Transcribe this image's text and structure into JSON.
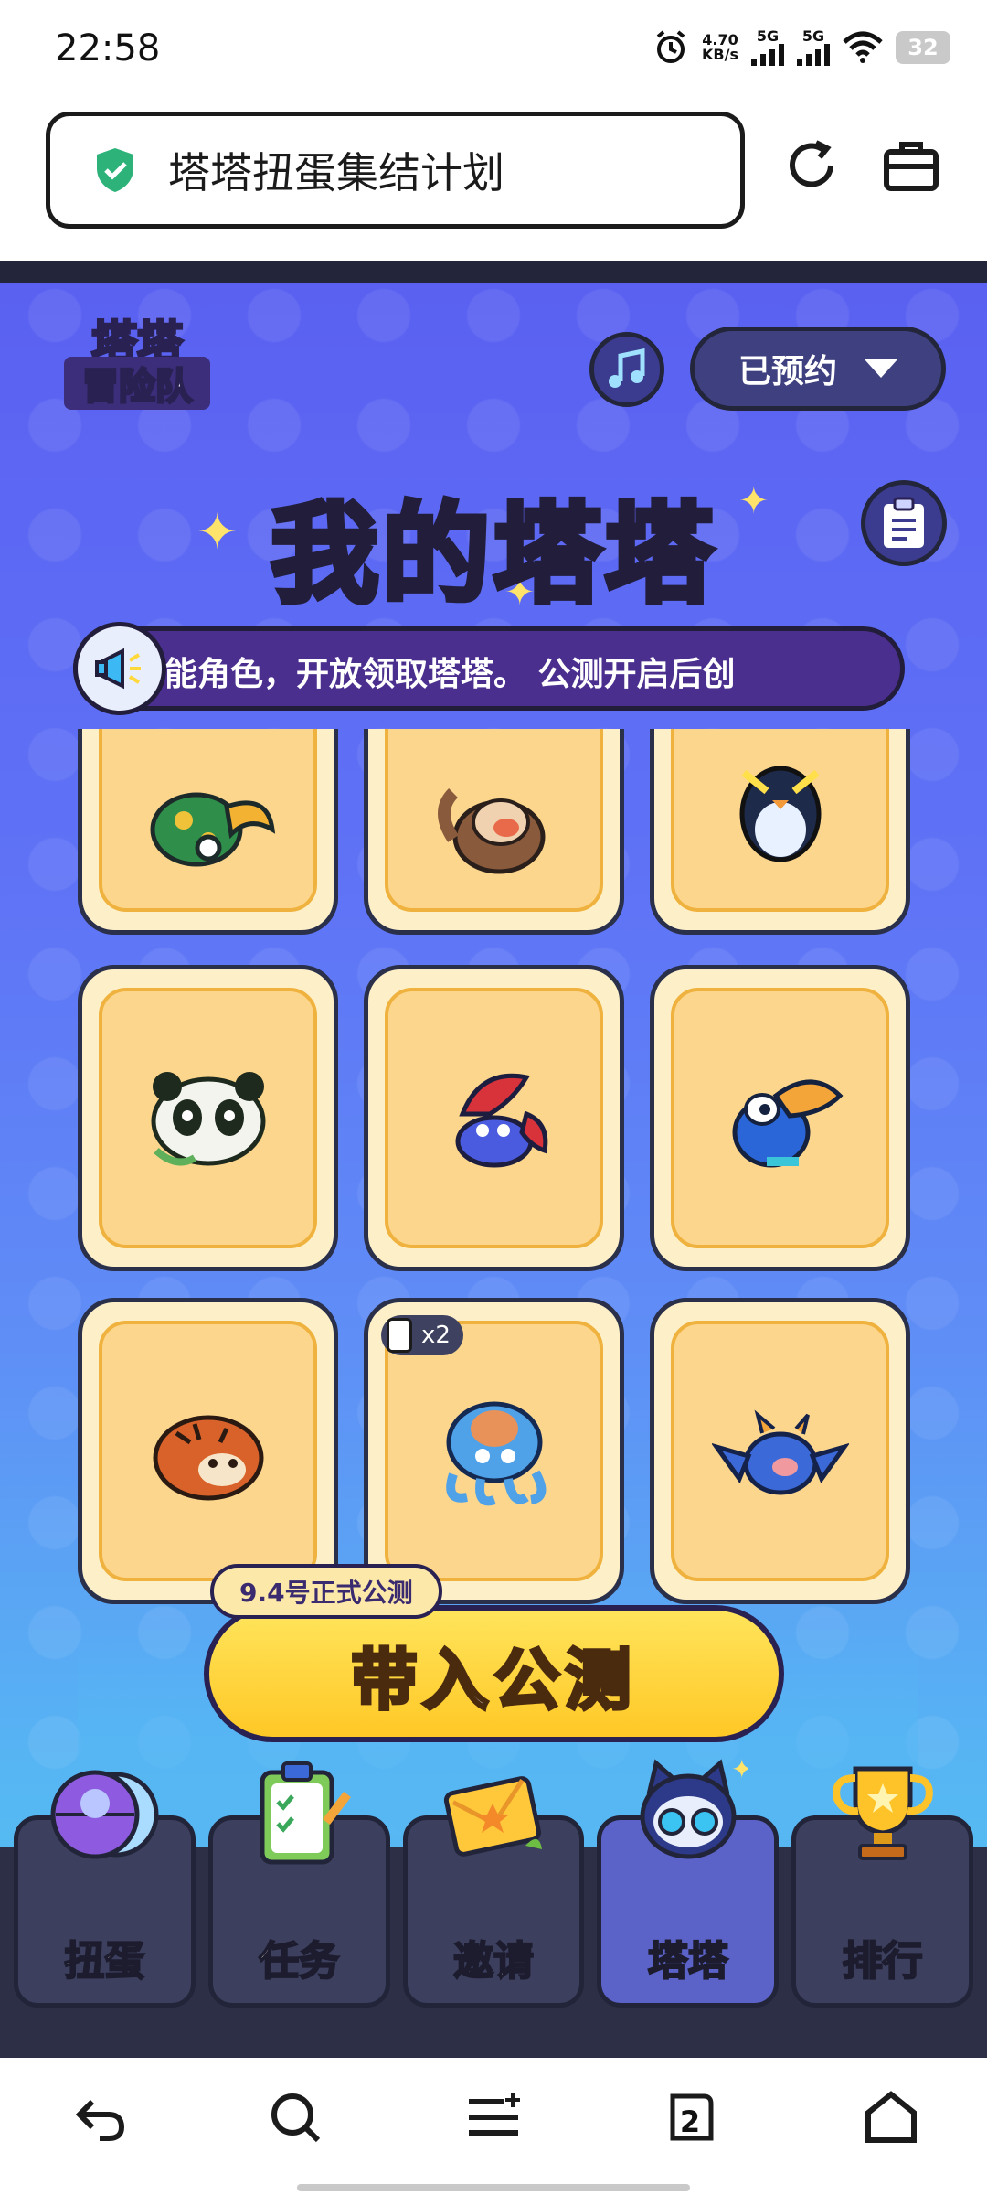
{
  "status_bar": {
    "time": "22:58",
    "net_speed_value": "4.70",
    "net_speed_unit": "KB/s",
    "sim1": "5G",
    "sim2": "5G",
    "battery": "32"
  },
  "browser": {
    "page_title": "塔塔扭蛋集结计划"
  },
  "game": {
    "logo_line1": "塔塔",
    "logo_line2": "冒险队",
    "reserve_label": "已预约",
    "title": "我的塔塔",
    "marquee": "能角色，开放领取塔塔。        公测开启后创",
    "cards": [
      {
        "creature": "green-turtle-bird"
      },
      {
        "creature": "brown-monkey"
      },
      {
        "creature": "rockhopper-penguin"
      },
      {
        "creature": "panda"
      },
      {
        "creature": "blue-crab"
      },
      {
        "creature": "toucan"
      },
      {
        "creature": "tiger"
      },
      {
        "creature": "blue-octopus",
        "count": "x2"
      },
      {
        "creature": "blue-bat-pig"
      }
    ],
    "cta_tag": "9.4号正式公测",
    "cta_label": "带入公测",
    "tabs": [
      {
        "label": "扭蛋",
        "icon": "capsule-icon"
      },
      {
        "label": "任务",
        "icon": "clipboard-icon"
      },
      {
        "label": "邀请",
        "icon": "envelope-icon"
      },
      {
        "label": "塔塔",
        "icon": "robot-cat-icon",
        "active": true
      },
      {
        "label": "排行",
        "icon": "trophy-icon"
      }
    ]
  },
  "navbar": {
    "tab_count": "2"
  },
  "colors": {
    "accent_yellow": "#ffd83b",
    "bg_top": "#5a60f1",
    "bg_bottom": "#52c5ef",
    "card_bg": "#fcd68c",
    "dark_outline": "#23263a",
    "shield_green": "#2db37a"
  }
}
